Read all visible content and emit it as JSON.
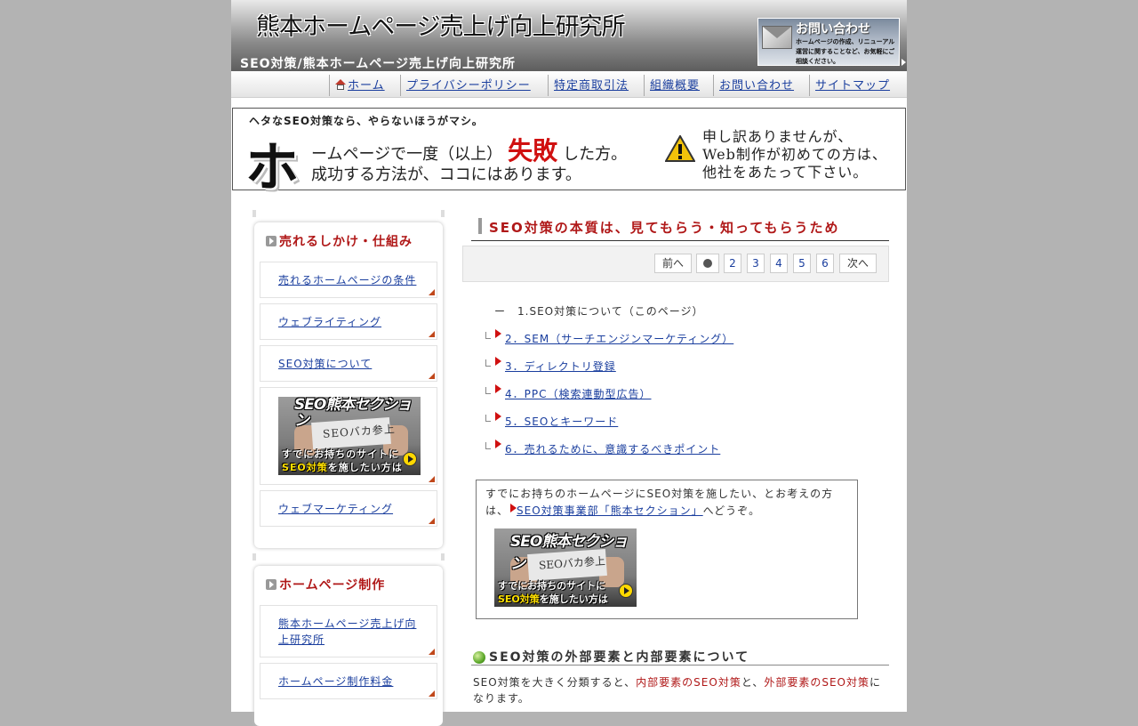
{
  "header": {
    "site_title": "熊本ホームページ売上げ向上研究所",
    "subtitle": "SEO対策/熊本ホームページ売上げ向上研究所",
    "contact_banner": {
      "title": "お問い合わせ",
      "text": "ホームページの作成、リニューアル運営に関することなど、お気軽にご相談ください。"
    }
  },
  "nav": {
    "items": [
      {
        "label": "ホーム",
        "icon": "home-icon"
      },
      {
        "label": "プライバシーポリシー"
      },
      {
        "label": "特定商取引法"
      },
      {
        "label": "組織概要"
      },
      {
        "label": "お問い合わせ"
      },
      {
        "label": "サイトマップ"
      }
    ]
  },
  "banner": {
    "lead": "ヘタなSEO対策なら、やらないほうがマシ。",
    "big_char": "ホ",
    "line1_pre": "ームページで一度（以上）",
    "line1_red": "失敗",
    "line1_post": "した方。",
    "line2": "成功する方法が、ココにはあります。",
    "sorry_1": "申し訳ありませんが、",
    "sorry_2": "Web制作が初めての方は、",
    "sorry_3": "他社をあたって下さい。"
  },
  "sidebar": {
    "box1": {
      "title": "売れるしかけ・仕組み",
      "items": [
        "売れるホームページの条件",
        "ウェブライティング",
        "SEO対策について",
        "ウェブマーケティング"
      ]
    },
    "box2": {
      "title": "ホームページ制作",
      "items": [
        "熊本ホームページ売上げ向上研究所",
        "ホームページ制作料金"
      ]
    }
  },
  "seo_banner": {
    "title": "SEO熊本セクション",
    "board": "SEOバカ参上",
    "cap1": "すでにお持ちのサイトに",
    "cap2_yellow": "SEO対策",
    "cap2_rest": "を施したい方は"
  },
  "main": {
    "title": "SEO対策の本質は、見てもらう・知ってもらうため",
    "pager": {
      "prev": "前へ",
      "pages": [
        "2",
        "3",
        "4",
        "5",
        "6"
      ],
      "next": "次へ"
    },
    "toc": {
      "current_dash": "ー",
      "current": "1.SEO対策について（このページ）",
      "links": [
        "2．SEM（サーチエンジンマーケティング）",
        "3．ディレクトリ登録",
        "4．PPC（検索連動型広告）",
        "5．SEOとキーワード",
        "6．売れるために、意識するべきポイント"
      ]
    },
    "note": {
      "text_pre": "すでにお持ちのホームページにSEO対策を施したい、とお考えの方は、",
      "link": "SEO対策事業部「熊本セクション」",
      "text_post": "へどうぞ。"
    },
    "section_title": "SEO対策の外部要素と内部要素について",
    "intro_pre": "SEO対策を大きく分類すると、",
    "intro_red1": "内部要素のSEO対策",
    "intro_mid": "と、",
    "intro_red2": "外部要素のSEO対策",
    "intro_post": "になります。"
  },
  "colors": {
    "accent_red": "#b01818",
    "link_blue": "#1a3e9e",
    "page_bg": "#b3b3b3"
  }
}
